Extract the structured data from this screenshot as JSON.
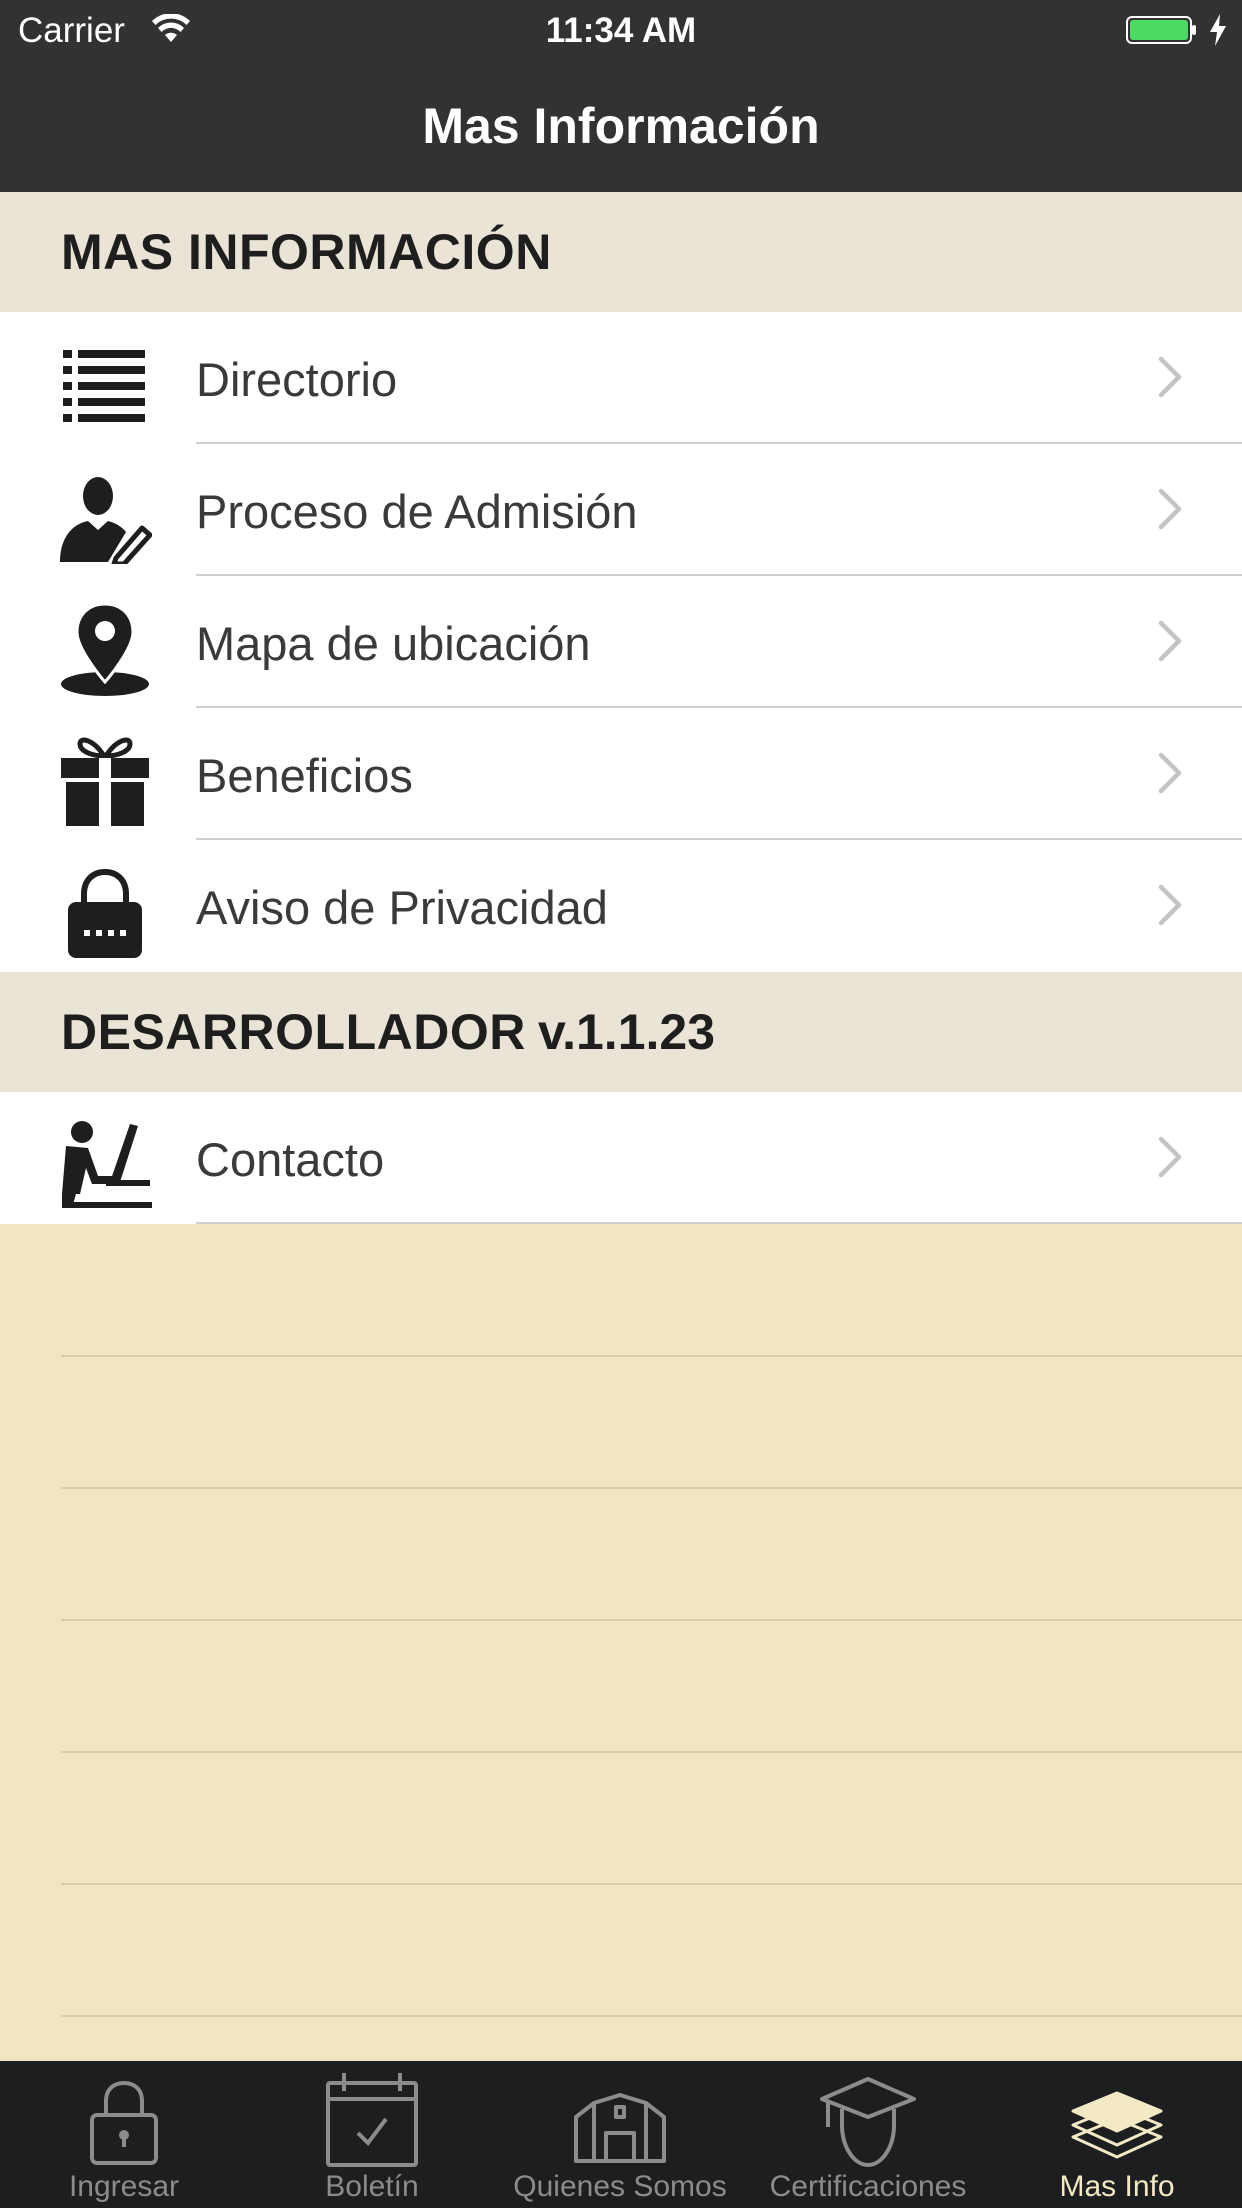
{
  "status_bar": {
    "carrier": "Carrier",
    "time": "11:34 AM",
    "battery_color": "#4cd964"
  },
  "nav": {
    "title": "Mas Información"
  },
  "sections": [
    {
      "header": "MAS INFORMACIÓN",
      "items": [
        {
          "label": "Directorio",
          "icon": "list-icon"
        },
        {
          "label": "Proceso de Admisión",
          "icon": "person-edit-icon"
        },
        {
          "label": "Mapa de ubicación",
          "icon": "map-pin-icon"
        },
        {
          "label": "Beneficios",
          "icon": "gift-icon"
        },
        {
          "label": "Aviso de Privacidad",
          "icon": "lock-password-icon"
        }
      ]
    },
    {
      "header": "DESARROLLADOR",
      "version": "v.1.1.23",
      "items": [
        {
          "label": "Contacto",
          "icon": "person-computer-icon"
        }
      ]
    }
  ],
  "tab_bar": {
    "tabs": [
      {
        "label": "Ingresar",
        "icon": "lock-icon",
        "active": false
      },
      {
        "label": "Boletín",
        "icon": "calendar-check-icon",
        "active": false
      },
      {
        "label": "Quienes Somos",
        "icon": "building-icon",
        "active": false
      },
      {
        "label": "Certificaciones",
        "icon": "graduate-icon",
        "active": false
      },
      {
        "label": "Mas Info",
        "icon": "layers-icon",
        "active": true
      }
    ],
    "active_color": "#f3e9c4",
    "inactive_color": "#8c8c8c"
  },
  "colors": {
    "bar_background": "#313234",
    "section_header_bg": "#e9e4d6",
    "page_background": "#f1e6c1"
  }
}
